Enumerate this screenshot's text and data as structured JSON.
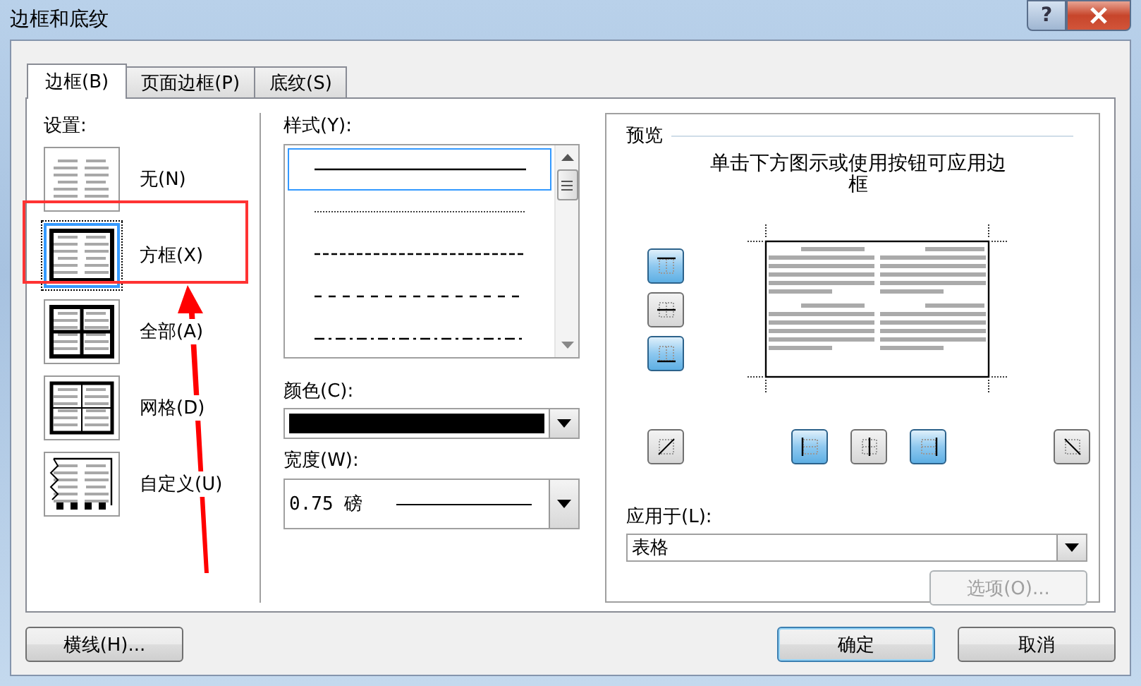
{
  "window": {
    "title": "边框和底纹",
    "help_label": "?"
  },
  "tabs": [
    {
      "label": "边框(B)",
      "selected": true
    },
    {
      "label": "页面边框(P)",
      "selected": false
    },
    {
      "label": "底纹(S)",
      "selected": false
    }
  ],
  "settings": {
    "label": "设置:",
    "items": [
      {
        "label": "无(N)",
        "kind": "none",
        "selected": false
      },
      {
        "label": "方框(X)",
        "kind": "box",
        "selected": true
      },
      {
        "label": "全部(A)",
        "kind": "all",
        "selected": false
      },
      {
        "label": "网格(D)",
        "kind": "grid",
        "selected": false
      },
      {
        "label": "自定义(U)",
        "kind": "custom",
        "selected": false
      }
    ]
  },
  "style": {
    "label": "样式(Y):",
    "items": [
      {
        "kind": "solid",
        "selected": true
      },
      {
        "kind": "dotted",
        "selected": false
      },
      {
        "kind": "dashed",
        "selected": false
      },
      {
        "kind": "dashed_wide",
        "selected": false
      },
      {
        "kind": "dash_dot",
        "selected": false
      }
    ]
  },
  "color": {
    "label": "颜色(C):",
    "color": "#000000"
  },
  "width": {
    "label": "宽度(W):",
    "value": "0.75 磅"
  },
  "preview": {
    "label": "预览",
    "hint": "单击下方图示或使用按钮可应用边框",
    "side_buttons": [
      {
        "kind": "top",
        "on": true
      },
      {
        "kind": "middle",
        "on": false
      },
      {
        "kind": "bottom",
        "on": true
      }
    ],
    "bottom_buttons": [
      {
        "kind": "diag_up",
        "on": false
      },
      {
        "kind": "left",
        "on": true
      },
      {
        "kind": "inner_v",
        "on": false
      },
      {
        "kind": "right",
        "on": true
      },
      {
        "kind": "diag_down",
        "on": false
      }
    ]
  },
  "apply_to": {
    "label": "应用于(L):",
    "value": "表格"
  },
  "options_button": {
    "label": "选项(O)...",
    "disabled": true
  },
  "footer": {
    "horizontal_line_button": "横线(H)...",
    "ok_button": "确定",
    "cancel_button": "取消"
  }
}
